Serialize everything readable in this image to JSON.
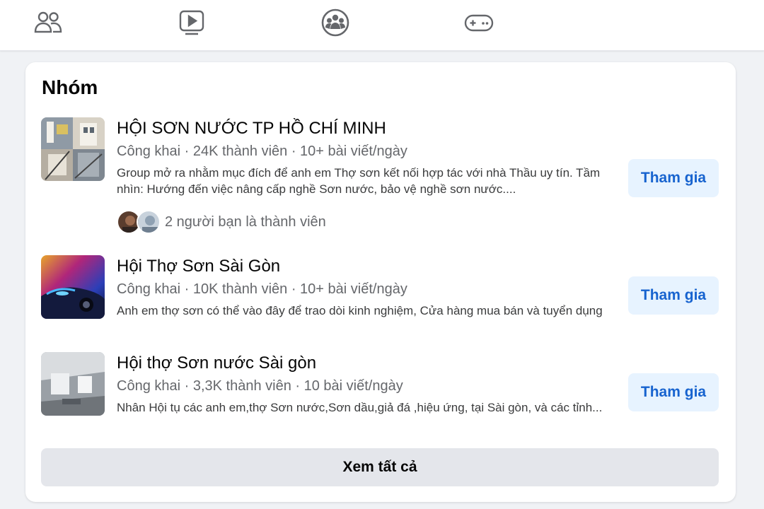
{
  "nav": {
    "icons": [
      "friends-icon",
      "watch-icon",
      "groups-icon",
      "gaming-icon"
    ]
  },
  "section": {
    "title": "Nhóm",
    "see_all_label": "Xem tất cả"
  },
  "groups": [
    {
      "name": "HỘI SƠN NƯỚC TP HỒ CHÍ MINH",
      "meta": "Công khai · 24K thành viên · 10+ bài viết/ngày",
      "description": "Group mở ra nhằm mục đích để anh em Thợ sơn kết nối hợp tác với nhà Thầu uy tín. Tầm nhìn: Hướng đến việc nâng cấp nghề Sơn nước, bảo vệ nghề sơn nước....",
      "friends_text": "2 người bạn là thành viên",
      "join_label": "Tham gia"
    },
    {
      "name": "Hội Thợ Sơn Sài Gòn",
      "meta": "Công khai · 10K thành viên · 10+ bài viết/ngày",
      "description": "Anh em thợ sơn có thể vào đây để trao dòi kinh nghiệm, Cửa hàng mua bán và tuyển dụng",
      "join_label": "Tham gia"
    },
    {
      "name": "Hội thợ Sơn nước Sài gòn",
      "meta": "Công khai · 3,3K thành viên · 10 bài viết/ngày",
      "description": "Nhân Hội tụ các anh em,thợ Sơn nước,Sơn dầu,giả đá ,hiệu ứng, tại Sài gòn, và các tỉnh...",
      "join_label": "Tham gia"
    }
  ],
  "colors": {
    "accent": "#1763cf",
    "join_bg": "#e7f3ff",
    "secondary_text": "#65676b",
    "page_bg": "#f0f2f5"
  }
}
